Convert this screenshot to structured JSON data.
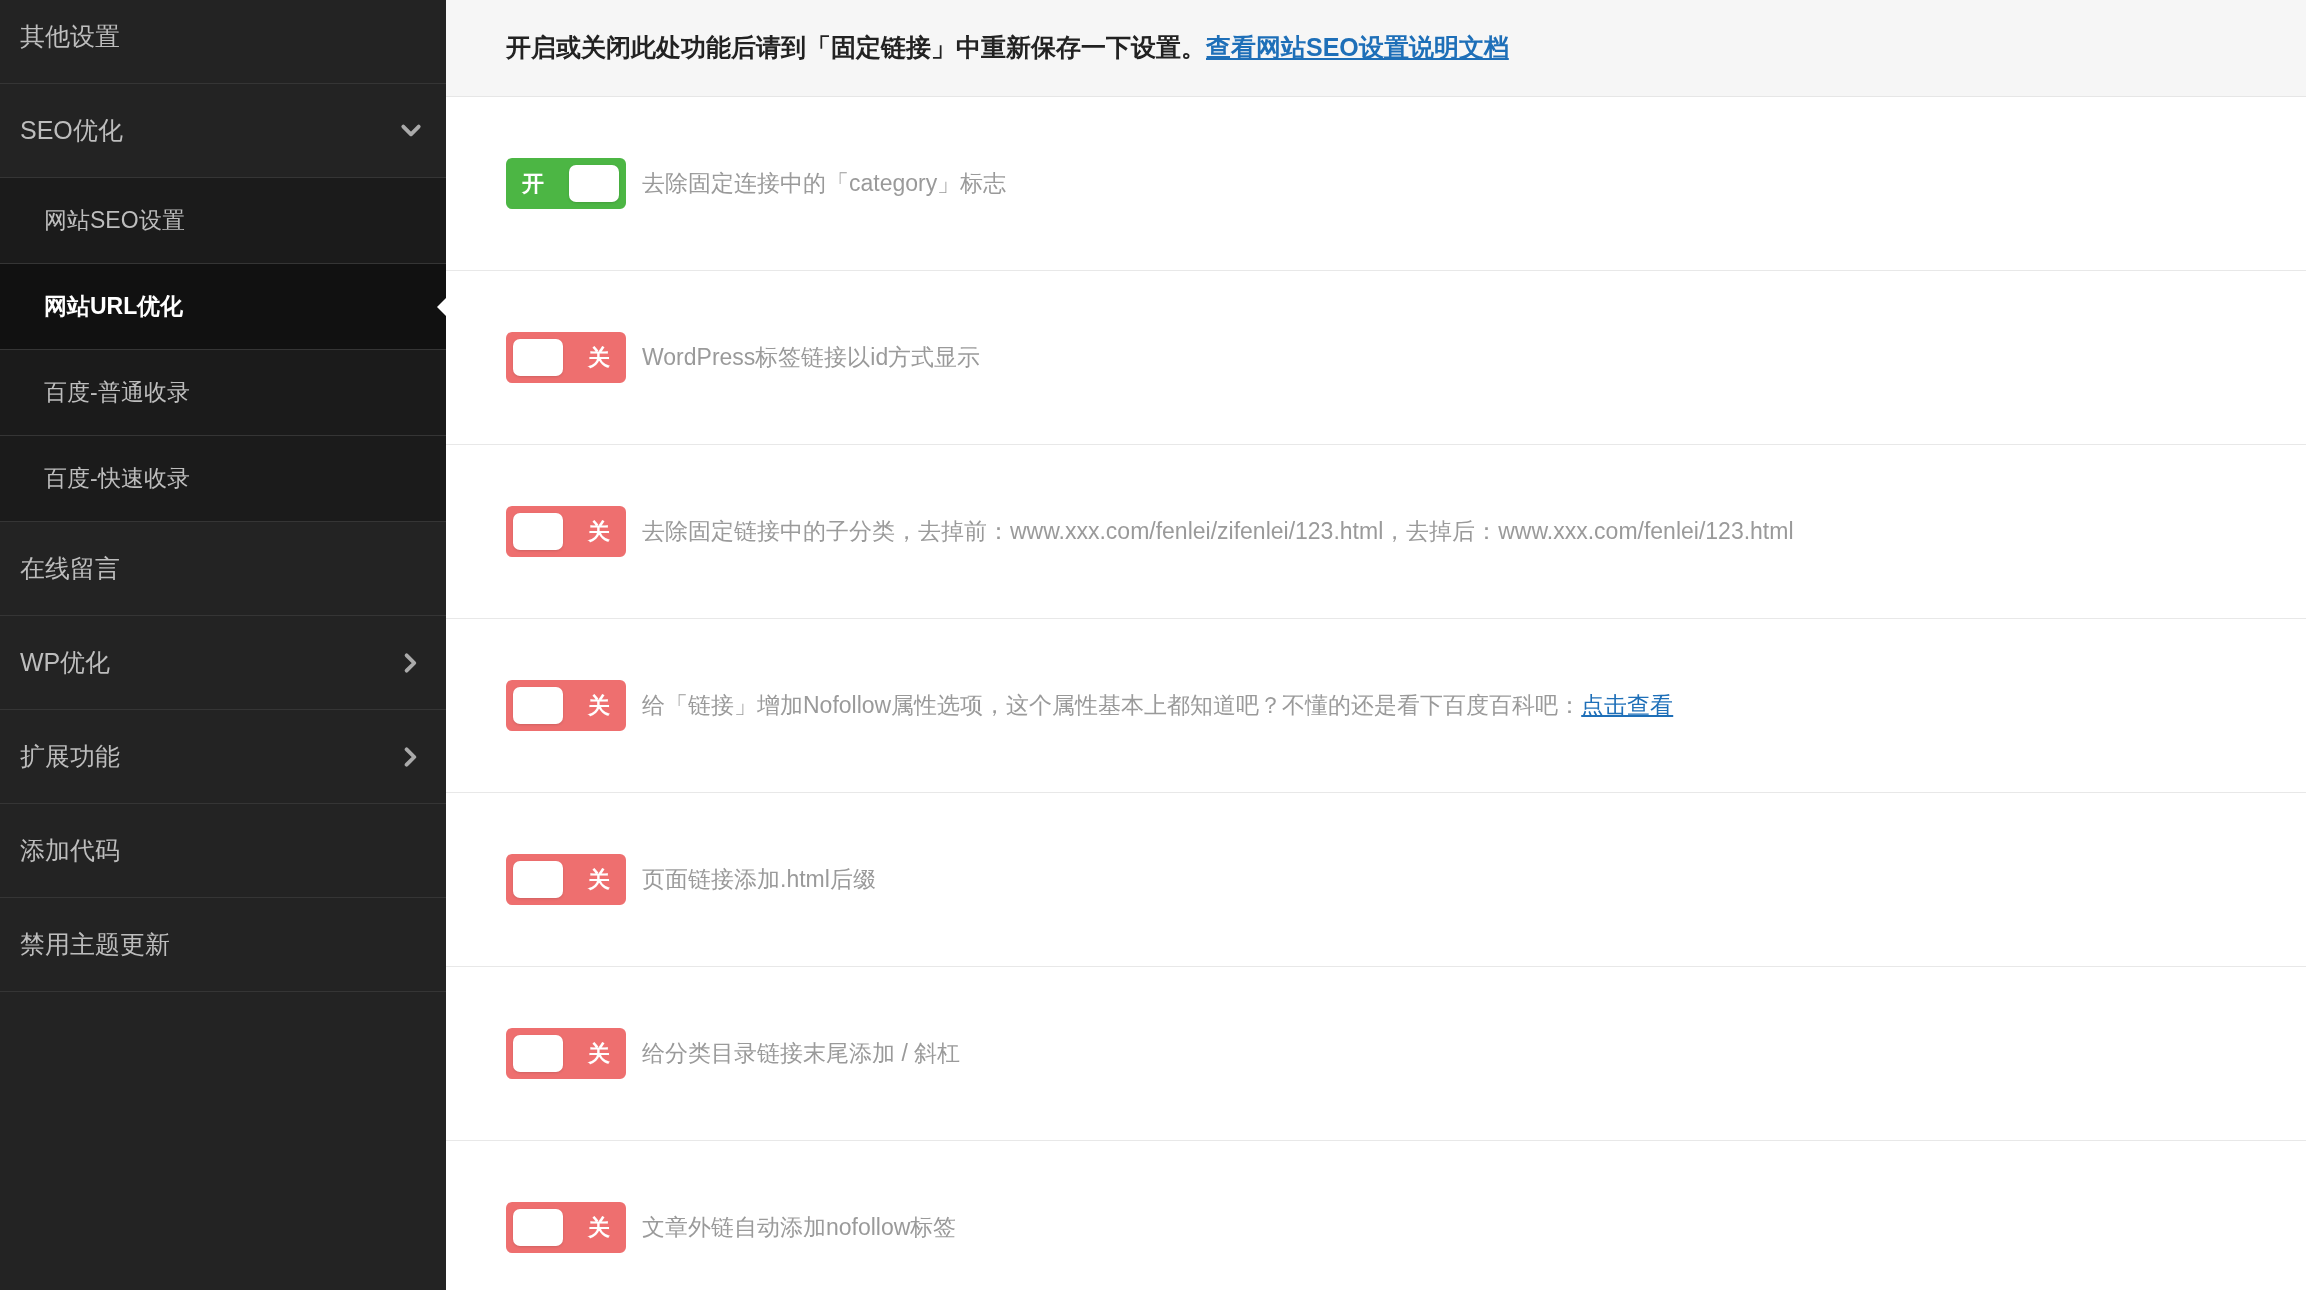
{
  "sidebar": {
    "items": [
      {
        "label": "其他设置"
      },
      {
        "label": "SEO优化",
        "expanded": true,
        "children": [
          {
            "label": "网站SEO设置",
            "selected": false
          },
          {
            "label": "网站URL优化",
            "selected": true
          },
          {
            "label": "百度-普通收录",
            "selected": false
          },
          {
            "label": "百度-快速收录",
            "selected": false
          }
        ]
      },
      {
        "label": "在线留言"
      },
      {
        "label": "WP优化",
        "expanded": false
      },
      {
        "label": "扩展功能",
        "expanded": false
      },
      {
        "label": "添加代码"
      },
      {
        "label": "禁用主题更新"
      }
    ]
  },
  "notice": {
    "text": "开启或关闭此处功能后请到「固定链接」中重新保存一下设置。",
    "link": "查看网站SEO设置说明文档"
  },
  "settings": [
    {
      "switch_label": "开",
      "on": true,
      "label": "去除固定连接中的「category」标志"
    },
    {
      "switch_label": "关",
      "on": false,
      "label": "WordPress标签链接以id方式显示"
    },
    {
      "switch_label": "关",
      "on": false,
      "label": "去除固定链接中的子分类，去掉前：www.xxx.com/fenlei/zifenlei/123.html，去掉后：www.xxx.com/fenlei/123.html"
    },
    {
      "switch_label": "关",
      "on": false,
      "label": "给「链接」增加Nofollow属性选项，这个属性基本上都知道吧？不懂的还是看下百度百科吧：",
      "link": "点击查看"
    },
    {
      "switch_label": "关",
      "on": false,
      "label": "页面链接添加.html后缀"
    },
    {
      "switch_label": "关",
      "on": false,
      "label": "给分类目录链接末尾添加 / 斜杠"
    },
    {
      "switch_label": "关",
      "on": false,
      "label": "文章外链自动添加nofollow标签"
    }
  ]
}
